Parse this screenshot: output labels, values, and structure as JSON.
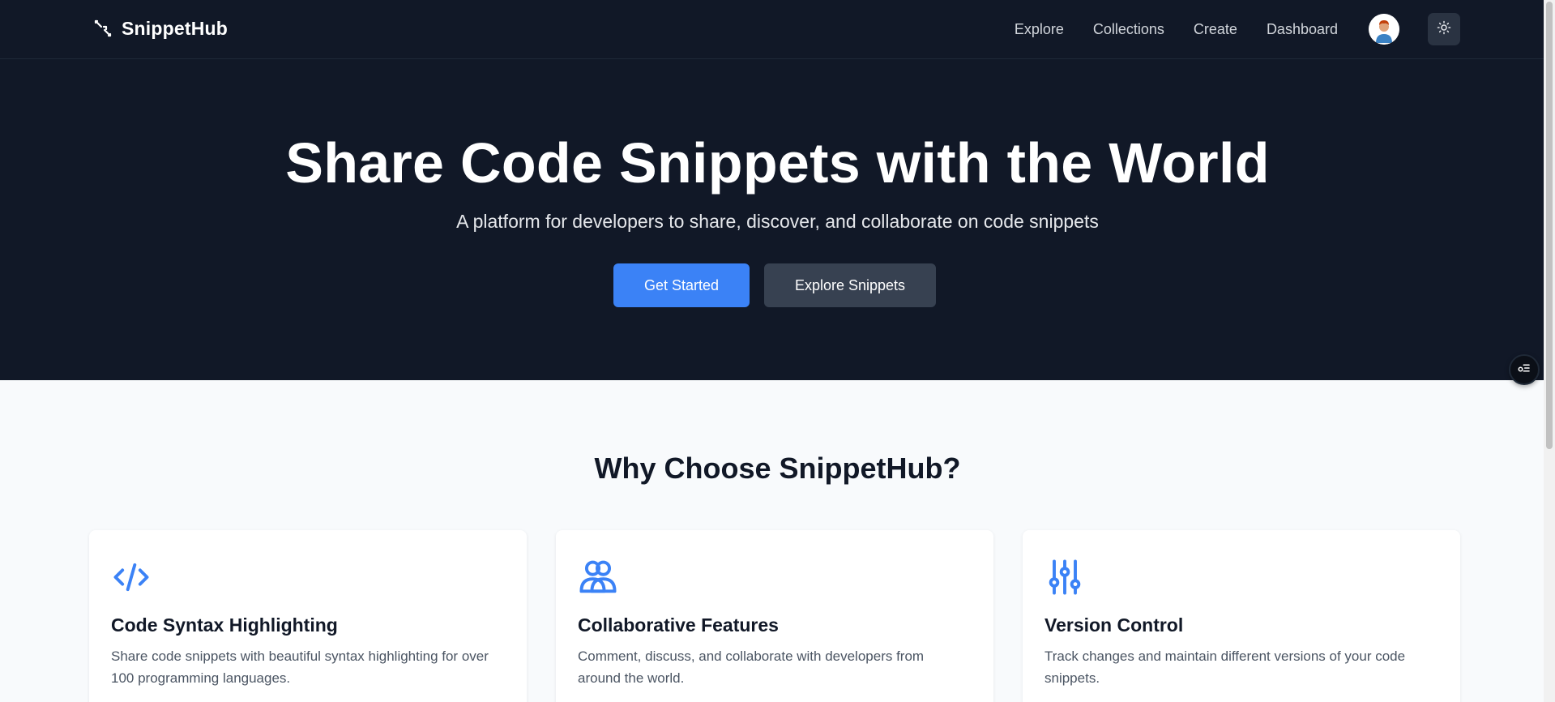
{
  "nav": {
    "brand": "SnippetHub",
    "links": [
      "Explore",
      "Collections",
      "Create",
      "Dashboard"
    ]
  },
  "hero": {
    "title": "Share Code Snippets with the World",
    "subtitle": "A platform for developers to share, discover, and collaborate on code snippets",
    "primary_button": "Get Started",
    "secondary_button": "Explore Snippets"
  },
  "features": {
    "title": "Why Choose SnippetHub?",
    "cards": [
      {
        "icon": "code-icon",
        "title": "Code Syntax Highlighting",
        "description": "Share code snippets with beautiful syntax highlighting for over 100 programming languages."
      },
      {
        "icon": "users-icon",
        "title": "Collaborative Features",
        "description": "Comment, discuss, and collaborate with developers from around the world."
      },
      {
        "icon": "sliders-icon",
        "title": "Version Control",
        "description": "Track changes and maintain different versions of your code snippets."
      }
    ]
  },
  "colors": {
    "dark_bg": "#111827",
    "accent": "#3b82f6",
    "secondary_button": "#374151",
    "page_bg": "#f8fafc"
  }
}
